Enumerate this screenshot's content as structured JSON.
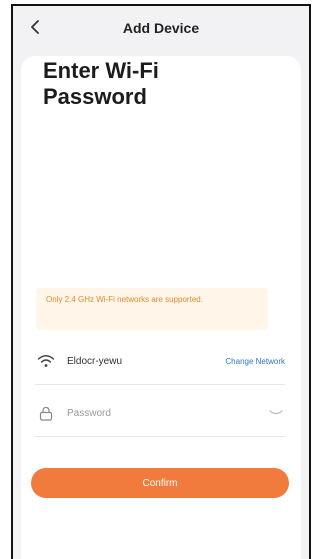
{
  "header": {
    "back_icon": "chevron-left-icon",
    "title": "Add Device"
  },
  "main": {
    "heading": "Enter Wi-Fi Password",
    "notice": "Only 2.4 GHz Wi-Fi networks are supported.",
    "network": {
      "icon": "wifi-icon",
      "ssid": "Eldocr-yewu",
      "change_label": "Change Network"
    },
    "password": {
      "icon": "lock-icon",
      "placeholder": "Password",
      "toggle_icon": "eye-hidden-icon"
    },
    "confirm_label": "Confirm"
  },
  "colors": {
    "accent": "#f07b3c",
    "link": "#2f74c9",
    "notice_bg": "#fff5e9",
    "notice_text": "#e38a2a"
  }
}
